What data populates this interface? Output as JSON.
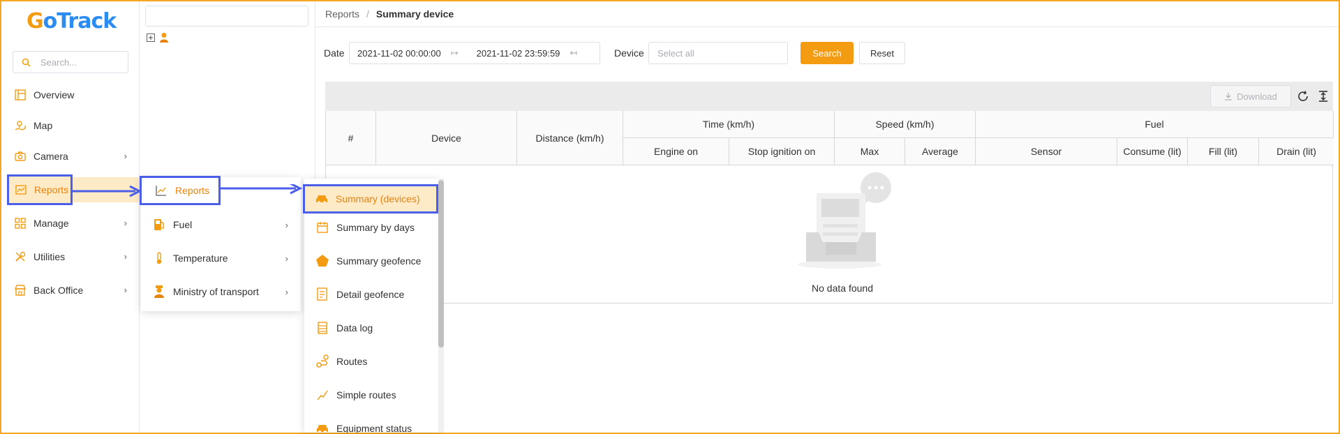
{
  "app": {
    "logo_g": "G",
    "logo_rest": "oTrack"
  },
  "sidebar": {
    "search_placeholder": "Search...",
    "items": [
      {
        "label": "Overview",
        "icon": "overview-icon"
      },
      {
        "label": "Map",
        "icon": "map-icon"
      },
      {
        "label": "Camera",
        "icon": "camera-icon",
        "has_children": true
      },
      {
        "label": "Reports",
        "icon": "chart-icon",
        "active": true
      },
      {
        "label": "Manage",
        "icon": "grid-icon",
        "has_children": true
      },
      {
        "label": "Utilities",
        "icon": "tools-icon",
        "has_children": true
      },
      {
        "label": "Back Office",
        "icon": "store-icon",
        "has_children": true
      }
    ]
  },
  "breadcrumb": {
    "parent": "Reports",
    "separator": "/",
    "current": "Summary device"
  },
  "filters": {
    "date_label": "Date",
    "date_start": "2021-11-02 00:00:00",
    "date_end": "2021-11-02 23:59:59",
    "device_label": "Device",
    "device_placeholder": "Select all",
    "search_label": "Search",
    "reset_label": "Reset"
  },
  "toolbar": {
    "download_label": "Download"
  },
  "table": {
    "headers": {
      "index": "#",
      "device": "Device",
      "distance": "Distance (km/h)",
      "time": "Time (km/h)",
      "engine_on": "Engine on",
      "stop_ignition_on": "Stop ignition on",
      "speed": "Speed (km/h)",
      "max": "Max",
      "average": "Average",
      "fuel": "Fuel",
      "sensor": "Sensor",
      "consume": "Consume (lit)",
      "fill": "Fill (lit)",
      "drain": "Drain (lit)"
    },
    "empty_text": "No data found"
  },
  "submenu_reports": {
    "items": [
      {
        "label": "Reports",
        "icon": "line-chart-icon"
      },
      {
        "label": "Fuel",
        "icon": "fuel-pump-icon",
        "has_children": true
      },
      {
        "label": "Temperature",
        "icon": "thermometer-icon",
        "has_children": true
      },
      {
        "label": "Ministry of transport",
        "icon": "officer-icon",
        "has_children": true
      }
    ]
  },
  "submenu_report_types": {
    "items": [
      {
        "label": "Summary (devices)",
        "icon": "car-icon",
        "active": true
      },
      {
        "label": "Summary by days",
        "icon": "calendar-icon"
      },
      {
        "label": "Summary geofence",
        "icon": "pentagon-icon"
      },
      {
        "label": "Detail geofence",
        "icon": "document-icon"
      },
      {
        "label": "Data log",
        "icon": "log-icon"
      },
      {
        "label": "Routes",
        "icon": "route-icon"
      },
      {
        "label": "Simple routes",
        "icon": "simple-route-icon"
      },
      {
        "label": "Equipment status",
        "icon": "car-icon"
      }
    ]
  },
  "colors": {
    "accent": "#f39c12",
    "highlight": "#4a5ee8",
    "active_bg": "#fdebc7"
  }
}
